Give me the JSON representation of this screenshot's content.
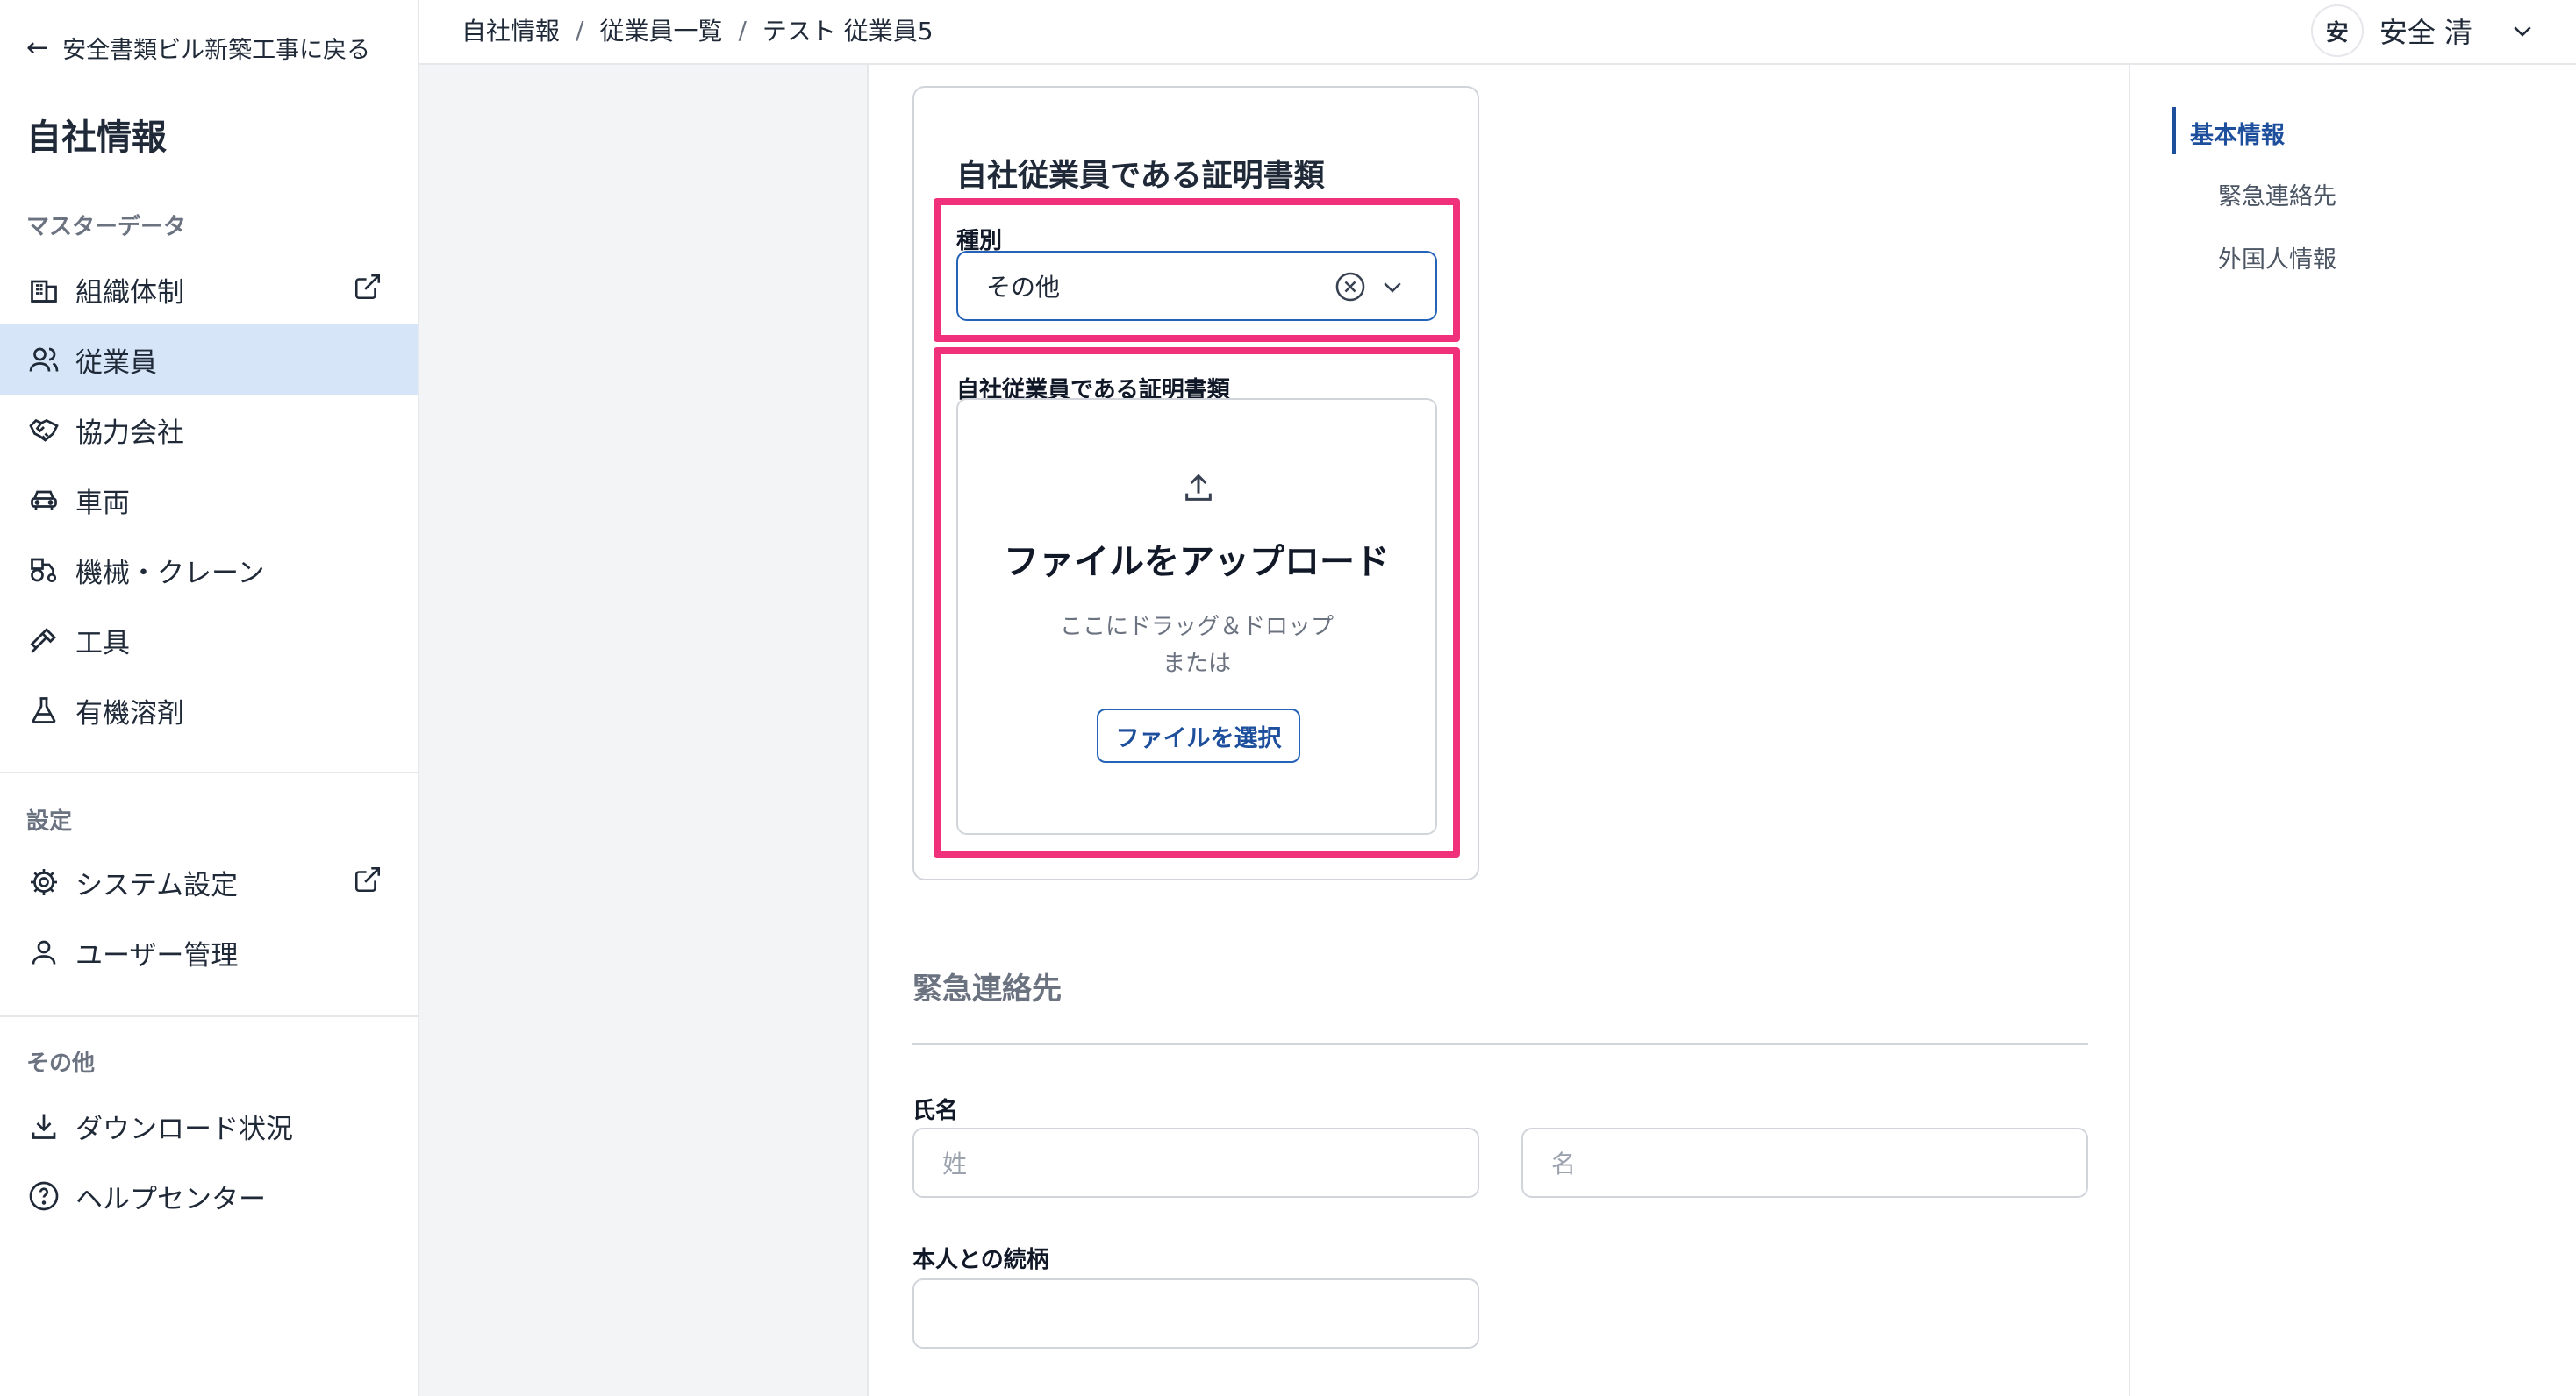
{
  "sidebar": {
    "back_label": "安全書類ビル新築工事に戻る",
    "title": "自社情報",
    "sections": [
      {
        "label": "マスターデータ",
        "items": [
          {
            "label": "組織体制",
            "icon": "building-icon",
            "external": true
          },
          {
            "label": "従業員",
            "icon": "users-icon",
            "active": true
          },
          {
            "label": "協力会社",
            "icon": "handshake-icon"
          },
          {
            "label": "車両",
            "icon": "car-icon"
          },
          {
            "label": "機械・クレーン",
            "icon": "tractor-icon"
          },
          {
            "label": "工具",
            "icon": "hammer-icon"
          },
          {
            "label": "有機溶剤",
            "icon": "flask-icon"
          }
        ]
      },
      {
        "label": "設定",
        "items": [
          {
            "label": "システム設定",
            "icon": "gear-icon",
            "external": true
          },
          {
            "label": "ユーザー管理",
            "icon": "user-icon"
          }
        ]
      },
      {
        "label": "その他",
        "items": [
          {
            "label": "ダウンロード状況",
            "icon": "download-icon"
          },
          {
            "label": "ヘルプセンター",
            "icon": "help-icon"
          }
        ]
      }
    ]
  },
  "header": {
    "breadcrumb": [
      "自社情報",
      "従業員一覧",
      "テスト 従業員5"
    ],
    "separator": "/",
    "avatar_initial": "安",
    "user_name": "安全 清"
  },
  "main": {
    "card_title": "自社従業員である証明書類",
    "type_field": {
      "label": "種別",
      "value": "その他"
    },
    "document_field": {
      "label": "自社従業員である証明書類",
      "upload_title": "ファイルをアップロード",
      "drag_text": "ここにドラッグ＆ドロップ",
      "or_text": "または",
      "select_button": "ファイルを選択"
    },
    "emergency": {
      "heading": "緊急連絡先",
      "name_label": "氏名",
      "last_name_placeholder": "姓",
      "first_name_placeholder": "名",
      "relation_label": "本人との続柄",
      "relation_value": ""
    }
  },
  "toc": {
    "items": [
      "基本情報",
      "緊急連絡先",
      "外国人情報"
    ],
    "active_index": 0
  },
  "colors": {
    "accent": "#1d4f9c",
    "active_nav_bg": "#d6e6f8",
    "highlight": "#f0307a"
  }
}
